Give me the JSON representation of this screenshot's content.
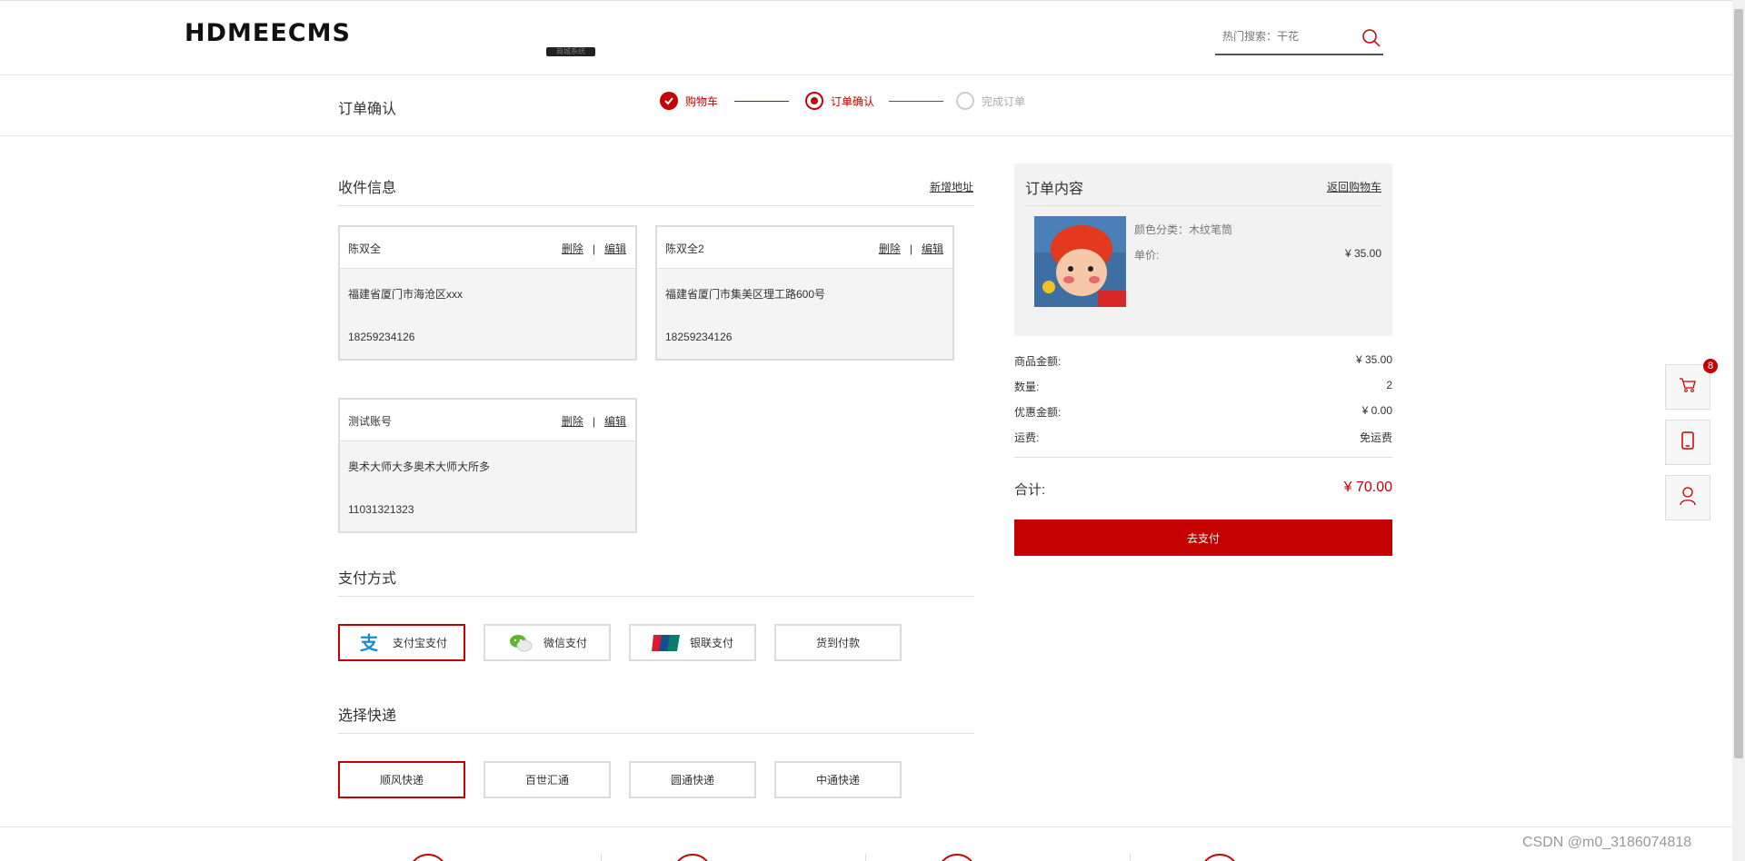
{
  "header": {
    "logo": "HDMEECMS",
    "logo_sub": "商城系统",
    "search_label": "热门搜索：干花"
  },
  "steps": {
    "page_title": "订单确认",
    "items": [
      {
        "label": "购物车",
        "state": "done"
      },
      {
        "label": "订单确认",
        "state": "current"
      },
      {
        "label": "完成订单",
        "state": "todo"
      }
    ]
  },
  "shipping": {
    "title": "收件信息",
    "add_link": "新增地址",
    "delete_label": "删除",
    "edit_label": "编辑",
    "separator": "|",
    "addresses": [
      {
        "name": "陈双全",
        "address": "福建省厦门市海沧区xxx",
        "phone": "18259234126"
      },
      {
        "name": "陈双全2",
        "address": "福建省厦门市集美区理工路600号",
        "phone": "18259234126"
      },
      {
        "name": "测试账号",
        "address": "奥术大师大多奥术大师大所多",
        "phone": "11031321323"
      }
    ]
  },
  "payment": {
    "title": "支付方式",
    "options": [
      {
        "label": "支付宝支付",
        "icon": "alipay-icon",
        "selected": true
      },
      {
        "label": "微信支付",
        "icon": "wechat-icon",
        "selected": false
      },
      {
        "label": "银联支付",
        "icon": "unionpay-icon",
        "selected": false
      },
      {
        "label": "货到付款",
        "icon": "",
        "selected": false
      }
    ]
  },
  "express": {
    "title": "选择快递",
    "options": [
      {
        "label": "顺风快递",
        "selected": true
      },
      {
        "label": "百世汇通",
        "selected": false
      },
      {
        "label": "圆通快递",
        "selected": false
      },
      {
        "label": "中通快递",
        "selected": false
      }
    ]
  },
  "order": {
    "title": "订单内容",
    "back_link": "返回购物车",
    "product": {
      "attr": "颜色分类：木纹笔筒",
      "price_label": "单价:",
      "price": "¥ 35.00"
    },
    "summary": [
      {
        "label": "商品金额:",
        "value": "¥ 35.00"
      },
      {
        "label": "数量:",
        "value": "2"
      },
      {
        "label": "优惠金额:",
        "value": "¥ 0.00"
      },
      {
        "label": "运费:",
        "value": "免运费"
      }
    ],
    "total_label": "合计:",
    "total_value": "¥ 70.00",
    "pay_button": "去支付"
  },
  "float": {
    "cart_badge": "8"
  },
  "watermark": "CSDN @m0_3186074818",
  "colors": {
    "accent": "#c40000",
    "border": "#dcdcdc"
  }
}
